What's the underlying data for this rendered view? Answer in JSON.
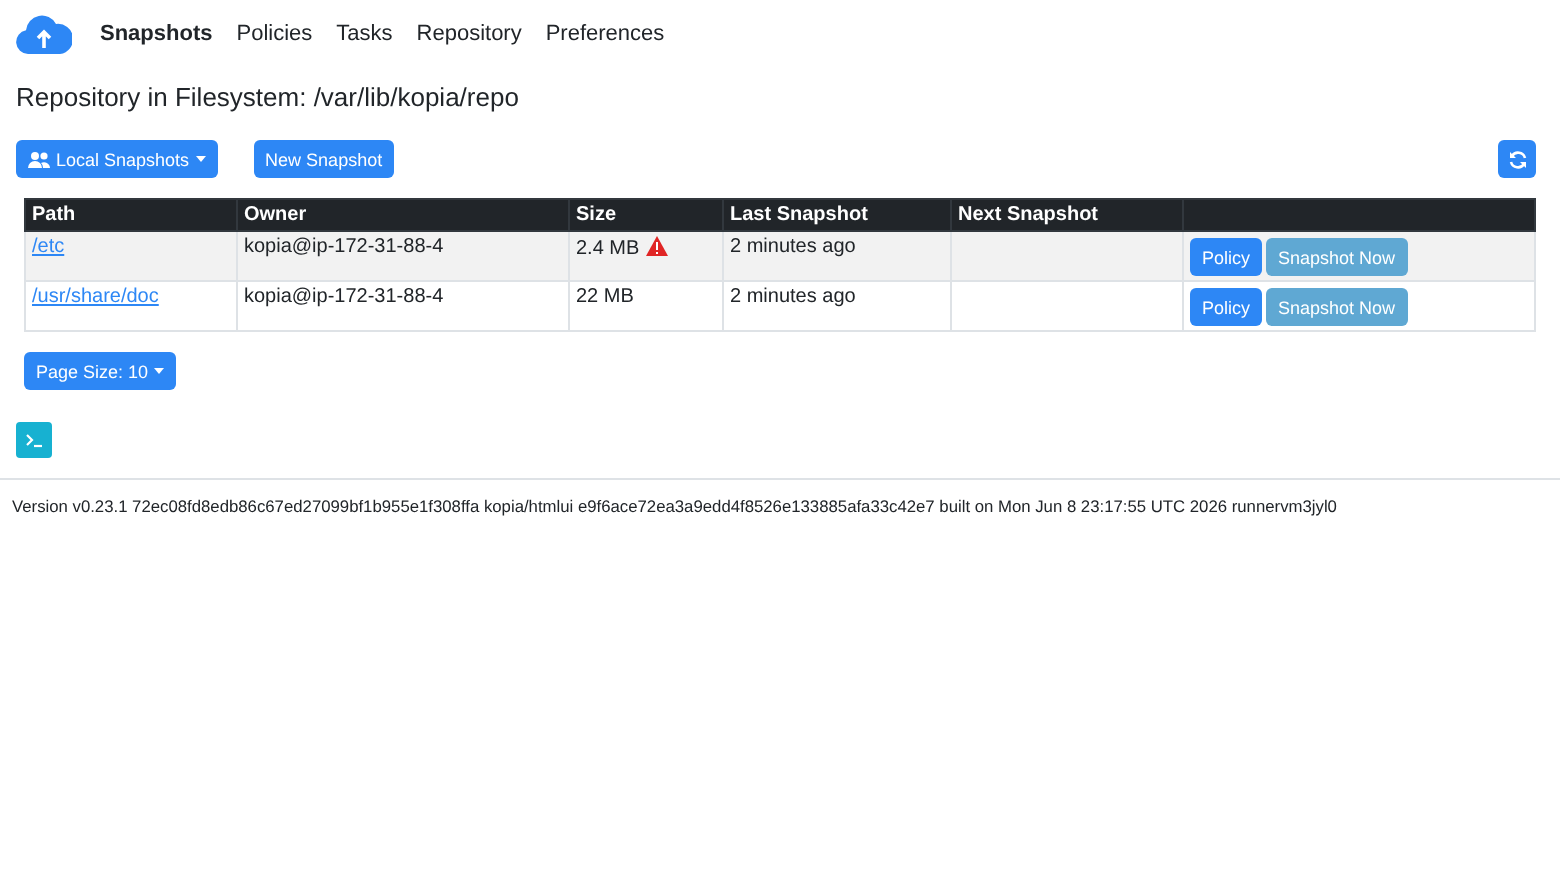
{
  "nav": [
    {
      "label": "Snapshots",
      "selected": true
    },
    {
      "label": "Policies",
      "selected": false
    },
    {
      "label": "Tasks",
      "selected": false
    },
    {
      "label": "Repository",
      "selected": false
    },
    {
      "label": "Preferences",
      "selected": false
    }
  ],
  "heading": "Repository in Filesystem: /var/lib/kopia/repo",
  "toolbar": {
    "scope_button": "Local Snapshots",
    "new_button": "New Snapshot"
  },
  "table": {
    "columns": [
      "Path",
      "Owner",
      "Size",
      "Last Snapshot",
      "Next Snapshot"
    ],
    "rows": [
      {
        "path": "/etc",
        "owner": "kopia@ip-172-31-88-4",
        "size": "2.4 MB",
        "warning": true,
        "last": "2 minutes ago",
        "next": "",
        "policy_button": "Policy",
        "snapshot_button": "Snapshot Now",
        "snapshot_disabled": true
      },
      {
        "path": "/usr/share/doc",
        "owner": "kopia@ip-172-31-88-4",
        "size": "22 MB",
        "warning": false,
        "last": "2 minutes ago",
        "next": "",
        "policy_button": "Policy",
        "snapshot_button": "Snapshot Now",
        "snapshot_disabled": true
      }
    ]
  },
  "page_size": "Page Size: 10",
  "status_bar": "Version v0.23.1 72ec08fd8edb86c67ed27099bf1b955e1f308ffa kopia/htmlui e9f6ace72ea3a9edd4f8526e133885afa33c42e7 built on Mon Jun 8 23:17:55 UTC 2026 runnervm3jyl0"
}
